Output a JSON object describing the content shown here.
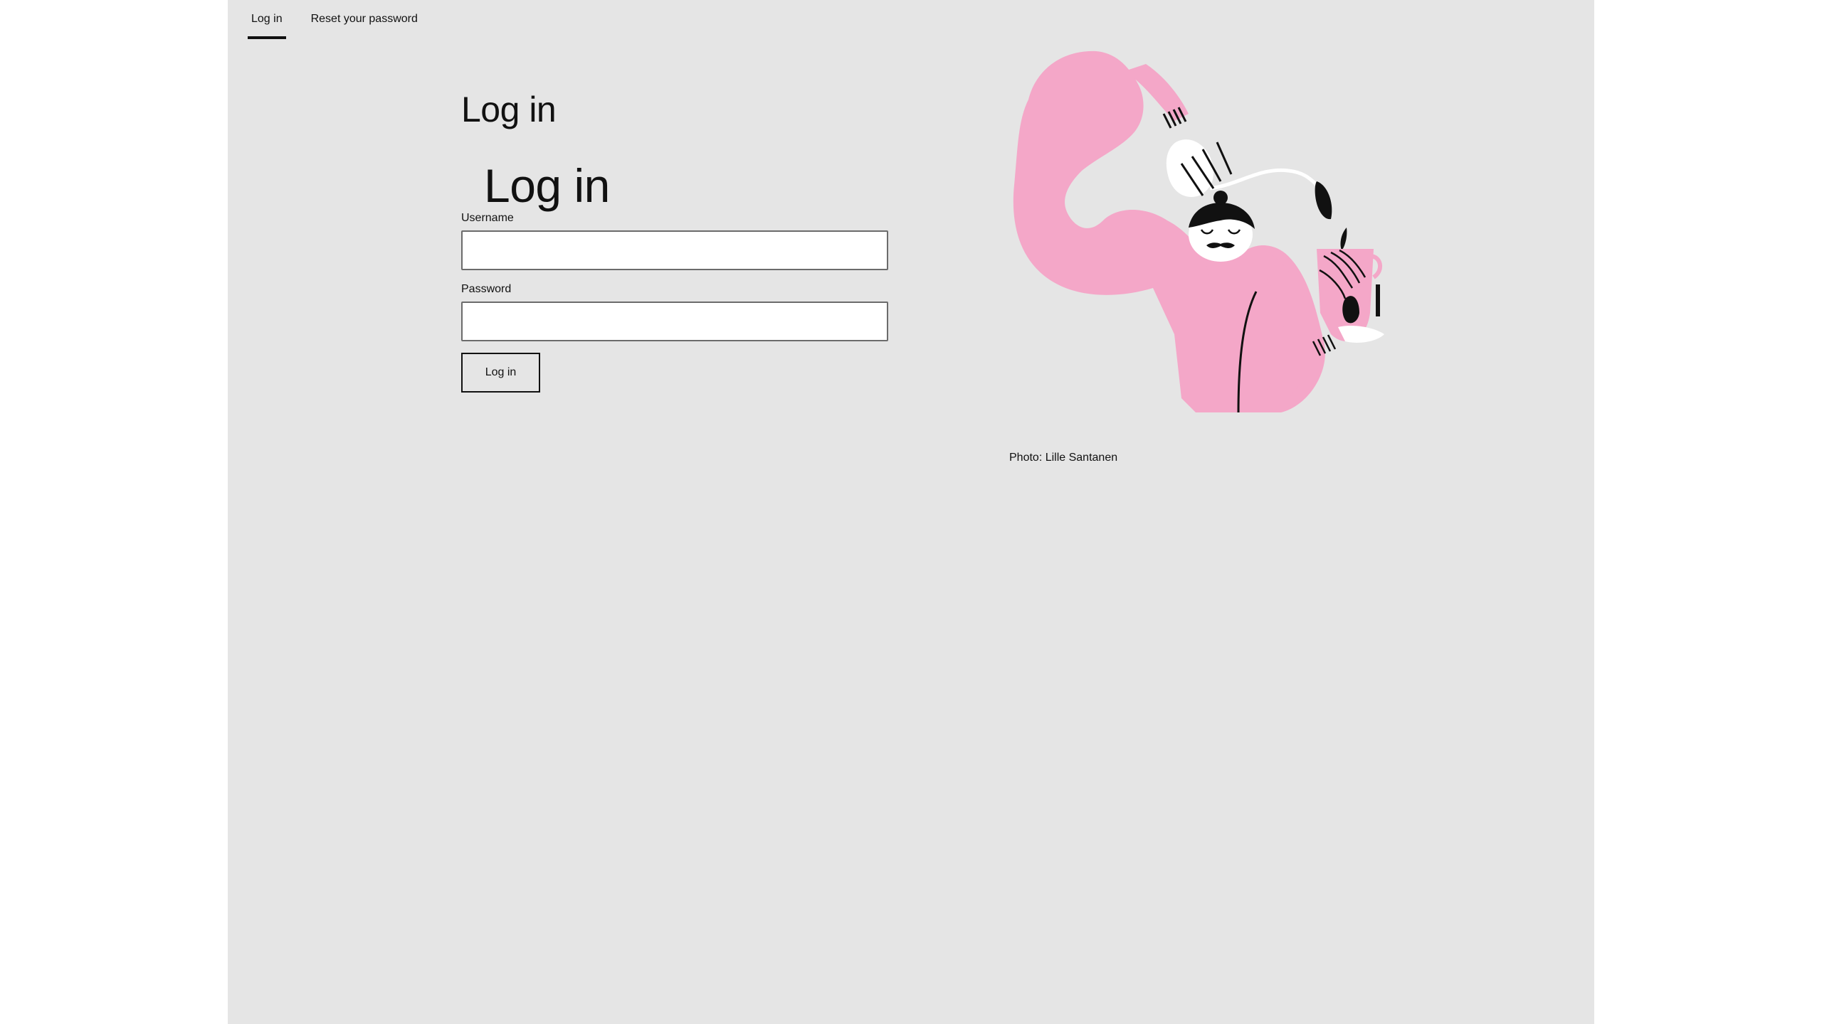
{
  "tabs": [
    {
      "label": "Log in",
      "active": true
    },
    {
      "label": "Reset your password",
      "active": false
    }
  ],
  "page_title": "Log in",
  "form_title": "Log in",
  "form": {
    "username_label": "Username",
    "username_value": "",
    "password_label": "Password",
    "password_value": "",
    "submit_label": "Log in"
  },
  "illustration": {
    "icon": "chef-pouring-illustration",
    "caption": "Photo: Lille Santanen",
    "colors": {
      "pink": "#f4a7c8",
      "black": "#111111",
      "white": "#ffffff"
    }
  },
  "colors": {
    "page_bg": "#e5e5e5",
    "outer_bg": "#ffffff",
    "accent": "#111111"
  }
}
